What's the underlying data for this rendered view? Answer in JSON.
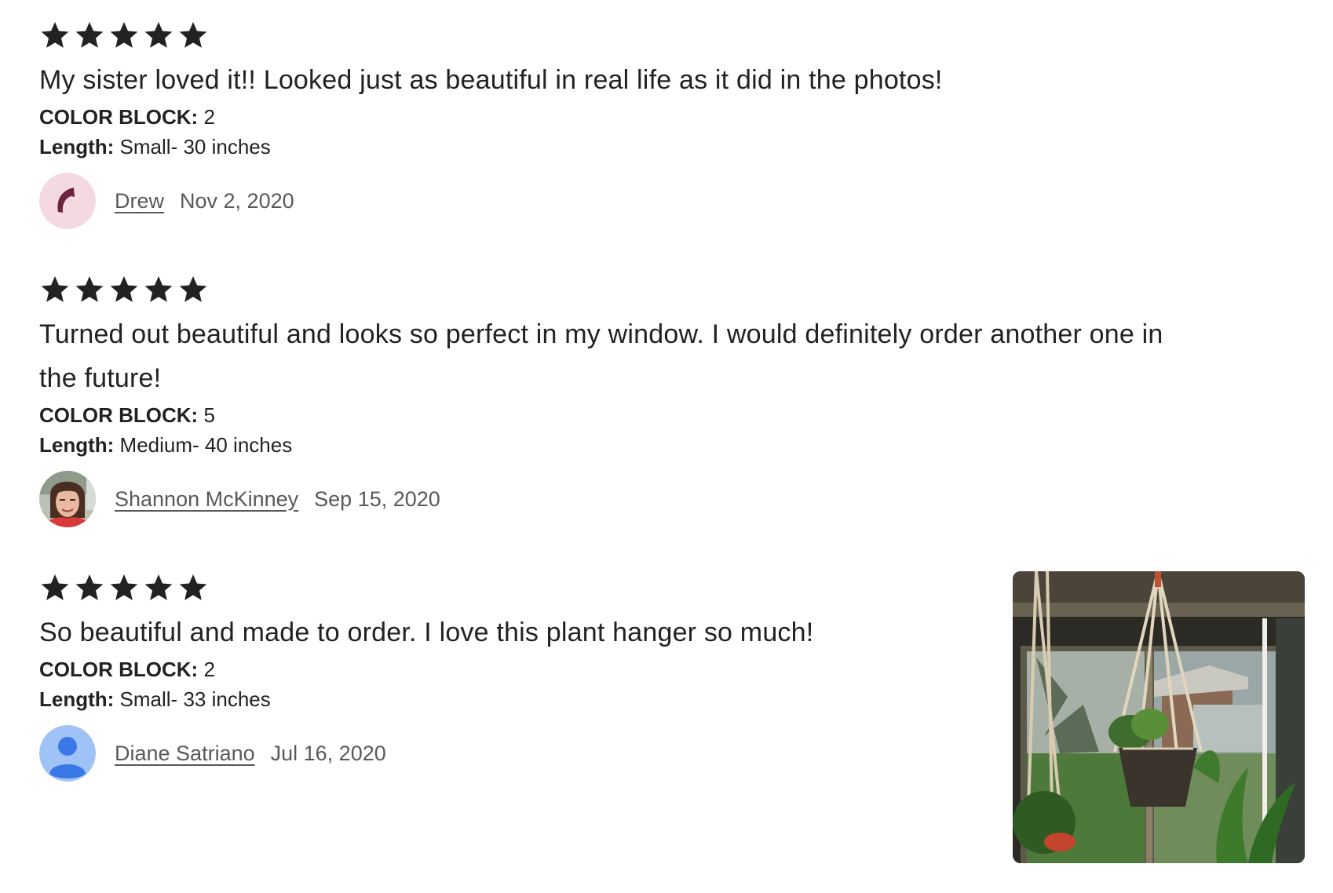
{
  "reviews": [
    {
      "rating": 5,
      "text": "My sister loved it!! Looked just as beautiful in real life as it did in the photos!",
      "variations": [
        {
          "label": "COLOR BLOCK:",
          "value": "2"
        },
        {
          "label": "Length:",
          "value": "Small- 30 inches"
        }
      ],
      "reviewer": "Drew",
      "date": "Nov 2, 2020"
    },
    {
      "rating": 5,
      "text": "Turned out beautiful and looks so perfect in my window. I would definitely order another one in the future!",
      "variations": [
        {
          "label": "COLOR BLOCK:",
          "value": "5"
        },
        {
          "label": "Length:",
          "value": "Medium- 40 inches"
        }
      ],
      "reviewer": "Shannon McKinney",
      "date": "Sep 15, 2020"
    },
    {
      "rating": 5,
      "text": "So beautiful and made to order. I love this plant hanger so much!",
      "variations": [
        {
          "label": "COLOR BLOCK:",
          "value": "2"
        },
        {
          "label": "Length:",
          "value": "Small- 33 inches"
        }
      ],
      "reviewer": "Diane Satriano",
      "date": "Jul 16, 2020"
    }
  ],
  "colors": {
    "star": "#222222",
    "text": "#222222",
    "muted": "#595959",
    "avatar_drew_bg": "#f4d9e1",
    "avatar_drew_fg": "#6b2340",
    "avatar_default_bg": "#9fc3f7",
    "avatar_default_fg": "#3b78e7"
  },
  "icons": {
    "star": "star-icon",
    "avatar_drew": "moon-glyph-avatar",
    "avatar_shannon": "photo-avatar",
    "avatar_diane": "default-person-avatar"
  }
}
